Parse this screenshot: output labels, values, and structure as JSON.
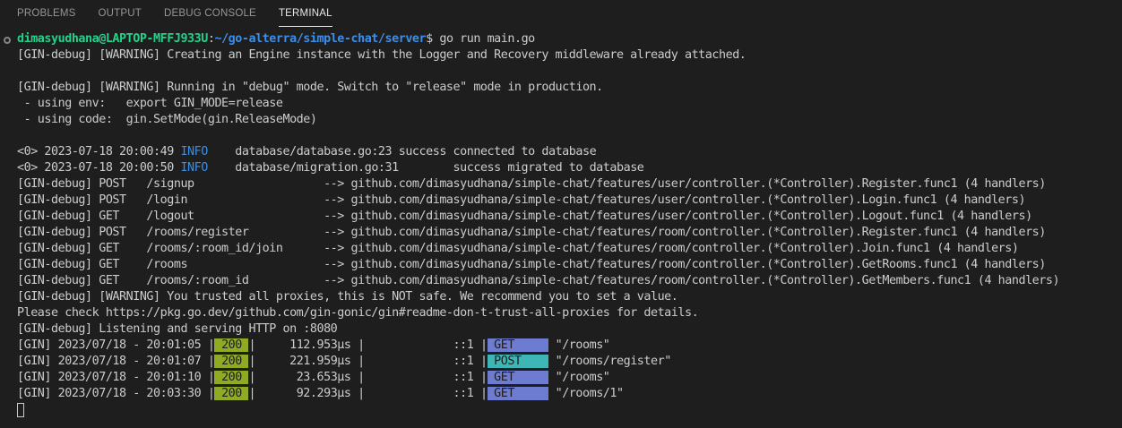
{
  "panel_tabs": [
    {
      "label": "PROBLEMS"
    },
    {
      "label": "OUTPUT"
    },
    {
      "label": "DEBUG CONSOLE"
    },
    {
      "label": "TERMINAL"
    }
  ],
  "prompt": {
    "user_host": "dimasyudhana@LAPTOP-MFFJ933U",
    "sep": ":",
    "path": "~/go-alterra/simple-chat/server",
    "symbol": "$ ",
    "command": "go run main.go"
  },
  "lines": {
    "l2": "[GIN-debug] [WARNING] Creating an Engine instance with the Logger and Recovery middleware already attached.",
    "l4": "[GIN-debug] [WARNING] Running in \"debug\" mode. Switch to \"release\" mode in production.",
    "l5": " - using env:   export GIN_MODE=release",
    "l6": " - using code:  gin.SetMode(gin.ReleaseMode)",
    "l8a": "<0> 2023-07-18 20:00:49 ",
    "l8b": "INFO",
    "l8c": "    database/database.go:23 success connected to database",
    "l9a": "<0> 2023-07-18 20:00:50 ",
    "l9b": "INFO",
    "l9c": "    database/migration.go:31        success migrated to database",
    "r1": "[GIN-debug] POST   /signup                   --> github.com/dimasyudhana/simple-chat/features/user/controller.(*Controller).Register.func1 (4 handlers)",
    "r2": "[GIN-debug] POST   /login                    --> github.com/dimasyudhana/simple-chat/features/user/controller.(*Controller).Login.func1 (4 handlers)",
    "r3": "[GIN-debug] GET    /logout                   --> github.com/dimasyudhana/simple-chat/features/user/controller.(*Controller).Logout.func1 (4 handlers)",
    "r4": "[GIN-debug] POST   /rooms/register           --> github.com/dimasyudhana/simple-chat/features/room/controller.(*Controller).Register.func1 (4 handlers)",
    "r5": "[GIN-debug] GET    /rooms/:room_id/join      --> github.com/dimasyudhana/simple-chat/features/room/controller.(*Controller).Join.func1 (4 handlers)",
    "r6": "[GIN-debug] GET    /rooms                    --> github.com/dimasyudhana/simple-chat/features/room/controller.(*Controller).GetRooms.func1 (4 handlers)",
    "r7": "[GIN-debug] GET    /rooms/:room_id           --> github.com/dimasyudhana/simple-chat/features/room/controller.(*Controller).GetMembers.func1 (4 handlers)",
    "w1": "[GIN-debug] [WARNING] You trusted all proxies, this is NOT safe. We recommend you to set a value.",
    "w2": "Please check https://pkg.go.dev/github.com/gin-gonic/gin#readme-don-t-trust-all-proxies for details.",
    "listen": "[GIN-debug] Listening and serving HTTP on :8080"
  },
  "requests": [
    {
      "pre": "[GIN] 2023/07/18 - 20:01:05 |",
      "status": " 200 ",
      "mid": "|     112.953µs |             ::1 |",
      "method": " GET     ",
      "path": " \"/rooms\""
    },
    {
      "pre": "[GIN] 2023/07/18 - 20:01:07 |",
      "status": " 200 ",
      "mid": "|     221.959µs |             ::1 |",
      "method": " POST    ",
      "path": " \"/rooms/register\""
    },
    {
      "pre": "[GIN] 2023/07/18 - 20:01:10 |",
      "status": " 200 ",
      "mid": "|      23.653µs |             ::1 |",
      "method": " GET     ",
      "path": " \"/rooms\""
    },
    {
      "pre": "[GIN] 2023/07/18 - 20:03:30 |",
      "status": " 200 ",
      "mid": "|      92.293µs |             ::1 |",
      "method": " GET     ",
      "path": " \"/rooms/1\""
    }
  ]
}
